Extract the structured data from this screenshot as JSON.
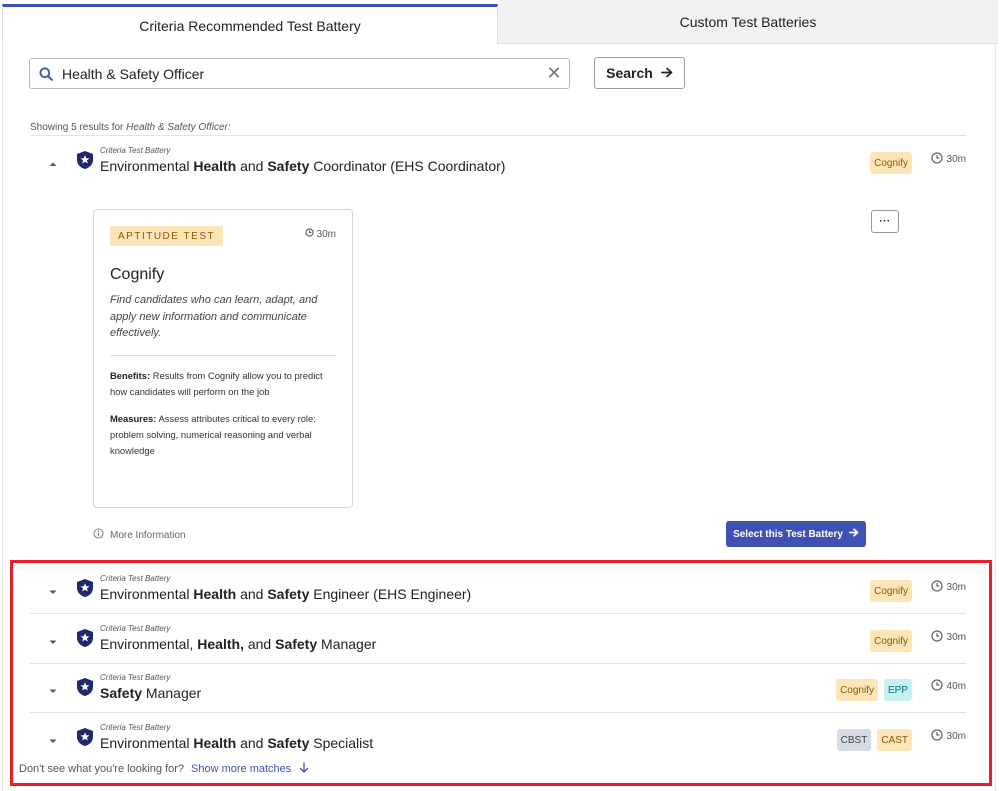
{
  "tabs": {
    "active": "Criteria Recommended Test Battery",
    "inactive": "Custom Test Batteries"
  },
  "search": {
    "value": "Health & Safety Officer",
    "button_label": "Search"
  },
  "results_info": {
    "prefix": "Showing 5 results for ",
    "query": "Health & Safety Officer:"
  },
  "rows": [
    {
      "kicker": "Criteria Test Battery",
      "title_parts": [
        {
          "t": "Environmental ",
          "b": false
        },
        {
          "t": "Health",
          "b": true
        },
        {
          "t": " and ",
          "b": false
        },
        {
          "t": "Safety",
          "b": true
        },
        {
          "t": " Coordinator (EHS Coordinator)",
          "b": false
        }
      ],
      "badges": [
        {
          "label": "Cognify",
          "kind": "cog"
        }
      ],
      "time": "30m",
      "expanded": true
    },
    {
      "kicker": "Criteria Test Battery",
      "title_parts": [
        {
          "t": "Environmental ",
          "b": false
        },
        {
          "t": "Health",
          "b": true
        },
        {
          "t": " and ",
          "b": false
        },
        {
          "t": "Safety",
          "b": true
        },
        {
          "t": " Engineer (EHS Engineer)",
          "b": false
        }
      ],
      "badges": [
        {
          "label": "Cognify",
          "kind": "cog"
        }
      ],
      "time": "30m",
      "expanded": false
    },
    {
      "kicker": "Criteria Test Battery",
      "title_parts": [
        {
          "t": "Environmental, ",
          "b": false
        },
        {
          "t": "Health,",
          "b": true
        },
        {
          "t": " and ",
          "b": false
        },
        {
          "t": "Safety",
          "b": true
        },
        {
          "t": " Manager",
          "b": false
        }
      ],
      "badges": [
        {
          "label": "Cognify",
          "kind": "cog"
        }
      ],
      "time": "30m",
      "expanded": false
    },
    {
      "kicker": "Criteria Test Battery",
      "title_parts": [
        {
          "t": "Safety",
          "b": true
        },
        {
          "t": " Manager",
          "b": false
        }
      ],
      "badges": [
        {
          "label": "Cognify",
          "kind": "cog"
        },
        {
          "label": "EPP",
          "kind": "epp"
        }
      ],
      "time": "40m",
      "expanded": false
    },
    {
      "kicker": "Criteria Test Battery",
      "title_parts": [
        {
          "t": "Environmental ",
          "b": false
        },
        {
          "t": "Health",
          "b": true
        },
        {
          "t": " and ",
          "b": false
        },
        {
          "t": "Safety",
          "b": true
        },
        {
          "t": " Specialist",
          "b": false
        }
      ],
      "badges": [
        {
          "label": "CBST",
          "kind": "cbst"
        },
        {
          "label": "CAST",
          "kind": "cast"
        }
      ],
      "time": "30m",
      "expanded": false
    }
  ],
  "card": {
    "pill": "APTITUDE TEST",
    "time": "30m",
    "title": "Cognify",
    "description": "Find candidates who can learn, adapt, and apply new information and communicate effectively.",
    "benefits_label": "Benefits:",
    "benefits_text": " Results from Cognify allow you to predict how candidates will perform on the job",
    "measures_label": "Measures:",
    "measures_text": " Assess attributes critical to every role: problem solving, numerical reasoning and verbal knowledge"
  },
  "actions": {
    "more_button": "···",
    "more_info": "More Information",
    "select_button": "Select this Test Battery"
  },
  "footer": {
    "prompt": "Don't see what you're looking for?",
    "link": "Show more matches"
  },
  "colors": {
    "accent": "#3f51b5",
    "highlight": "#e8202a",
    "cognify_badge": "#fde5b8",
    "epp_badge": "#c7f1f0",
    "cbst_badge": "#d7dbe4"
  }
}
